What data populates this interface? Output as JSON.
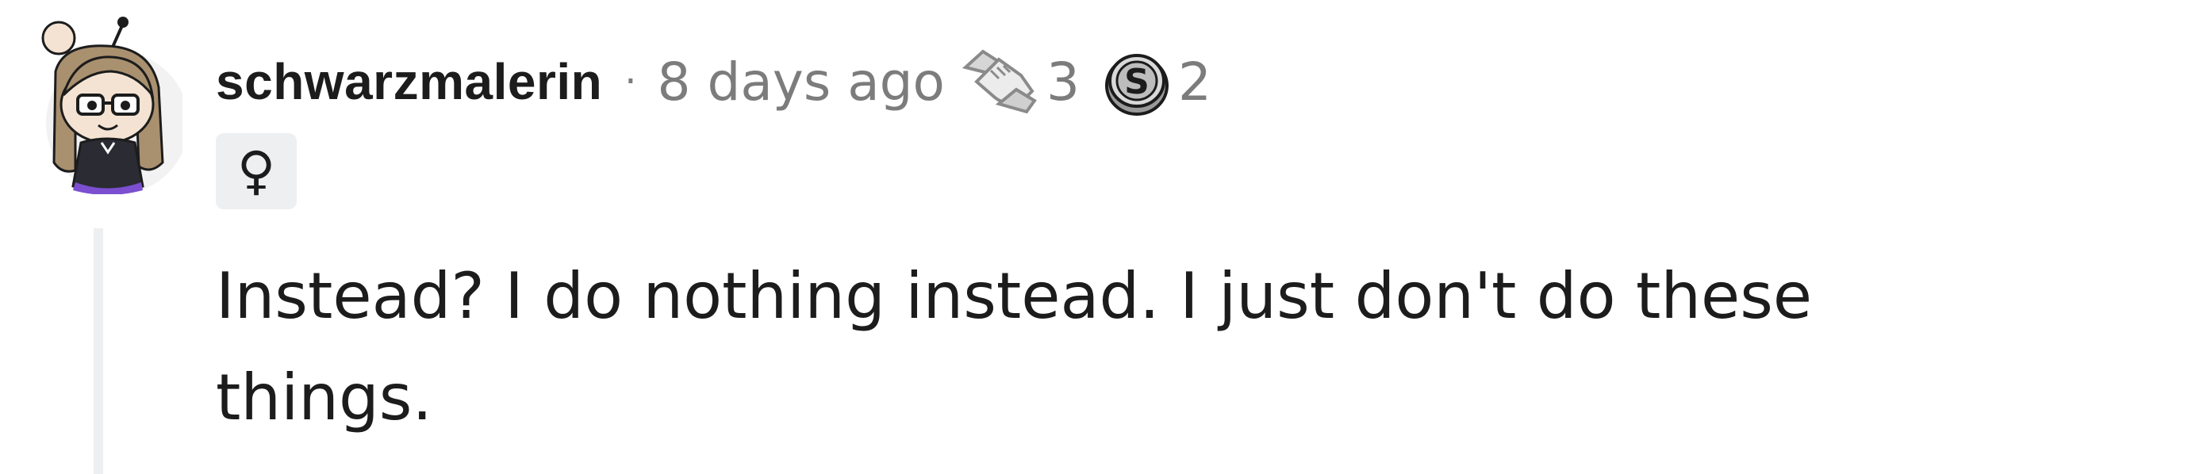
{
  "comment": {
    "username": "schwarzmalerin",
    "separator": "·",
    "timestamp": "8 days ago",
    "awards": [
      {
        "icon": "handshake-award-icon",
        "count": "3"
      },
      {
        "icon": "silver-coin-award-icon",
        "count": "2"
      }
    ],
    "flair": "♀",
    "body": "Instead? I do nothing instead. I just don't do these things."
  },
  "colors": {
    "text_primary": "#1c1c1c",
    "text_meta": "#7c7c7c",
    "thread_line": "#edeff1",
    "flair_bg": "#edeff1"
  }
}
